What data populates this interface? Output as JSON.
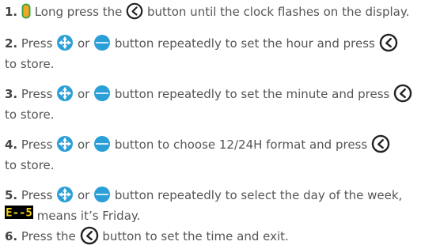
{
  "colors": {
    "text": "#555555",
    "accent_blue": "#2a9fd8",
    "battery_fill": "#f5a623",
    "battery_outline": "#3aa64a",
    "clock_stroke": "#222222",
    "display_bg": "#000000",
    "display_seg": "#f2d11a"
  },
  "icons": {
    "battery": "battery-icon",
    "clock": "clock-button-icon",
    "plus": "plus-button-icon",
    "minus": "minus-button-icon",
    "display": "lcd-display-icon"
  },
  "steps": [
    {
      "num": "1.",
      "parts": [
        "Long press the",
        "button until the clock flashes on the display."
      ]
    },
    {
      "num": "2.",
      "parts": [
        "Press",
        "or",
        "button repeatedly to set the hour and press",
        "to store."
      ]
    },
    {
      "num": "3.",
      "parts": [
        "Press",
        "or",
        "button repeatedly to set the minute and press",
        "to store."
      ]
    },
    {
      "num": "4.",
      "parts": [
        "Press",
        "or",
        "button to choose 12/24H format and press",
        "to store."
      ]
    },
    {
      "num": "5.",
      "parts": [
        "Press",
        "or",
        "button repeatedly to select the day of the week,",
        "means it’s Friday."
      ]
    },
    {
      "num": "6.",
      "parts": [
        "Press the",
        "button to set the time and exit."
      ]
    }
  ],
  "display": {
    "text": "E--5"
  }
}
